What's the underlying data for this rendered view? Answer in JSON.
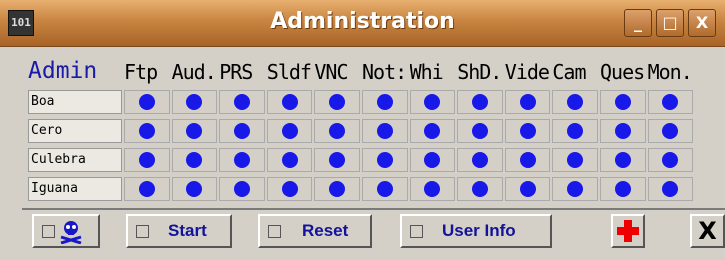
{
  "window": {
    "title": "Administration",
    "minimize_label": "_",
    "maximize_label": "□",
    "close_label": "X"
  },
  "grid": {
    "corner_label": "Admin",
    "columns": [
      "Ftp",
      "Aud.",
      "PRS",
      "Sldf",
      "VNC",
      "Not:",
      "Whi",
      "ShD.",
      "Vide",
      "Cam",
      "Ques",
      "Mon."
    ],
    "rows": [
      "Boa",
      "Cero",
      "Culebra",
      "Iguana"
    ]
  },
  "toolbar": {
    "start_label": "Start",
    "reset_label": "Reset",
    "userinfo_label": "User Info",
    "close_label": "X"
  },
  "colors": {
    "accent": "#1818e8",
    "title_bar": "#c88440",
    "red_cross": "#e00000"
  }
}
